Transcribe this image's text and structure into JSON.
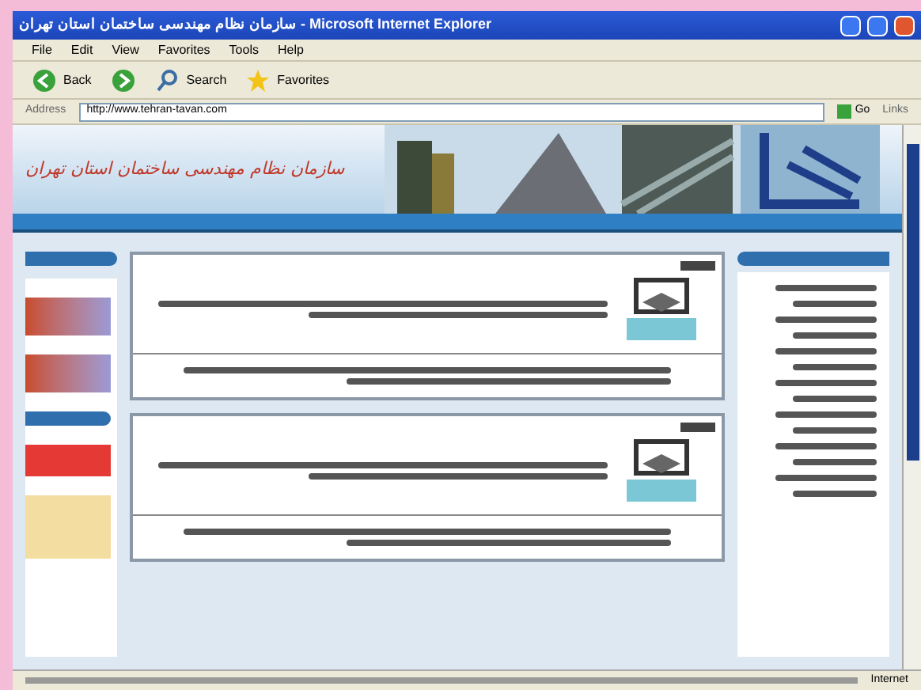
{
  "window": {
    "title": "سازمان نظام مهندسی ساختمان استان تهران - Microsoft Internet Explorer"
  },
  "menu": [
    "File",
    "Edit",
    "View",
    "Favorites",
    "Tools",
    "Help"
  ],
  "toolbar": [
    {
      "kind": "back",
      "label": "Back"
    },
    {
      "kind": "forward"
    },
    {
      "kind": "search",
      "label": "Search"
    },
    {
      "kind": "favorites",
      "label": "Favorites"
    }
  ],
  "address": {
    "label": "Address",
    "value": "http://www.tehran-tavan.com",
    "go": "Go",
    "links": "Links"
  },
  "banner": {
    "title": "سازمان نظام مهندسی ساختمان استان تهران"
  },
  "status_bar": {
    "zone": "Internet"
  }
}
